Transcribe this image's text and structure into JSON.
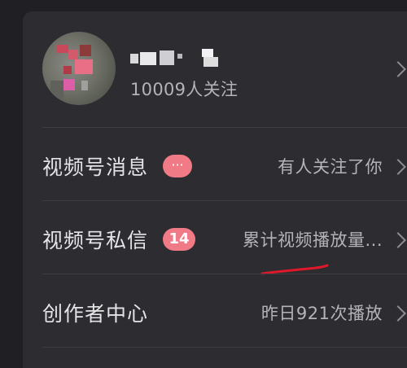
{
  "profile": {
    "followers_text": "10009人关注"
  },
  "rows": [
    {
      "label": "视频号消息",
      "badge": "···",
      "right_text": "有人关注了你"
    },
    {
      "label": "视频号私信",
      "badge": "14",
      "right_text": "累计视频播放量..."
    },
    {
      "label": "创作者中心",
      "right_text": "昨日921次播放"
    }
  ],
  "icons": {
    "chevron": "chevron-right-icon"
  },
  "colors": {
    "background": "#1f1f24",
    "card": "#2c2c31",
    "badge": "#f07a86",
    "annotation_underline": "#e0192a"
  }
}
